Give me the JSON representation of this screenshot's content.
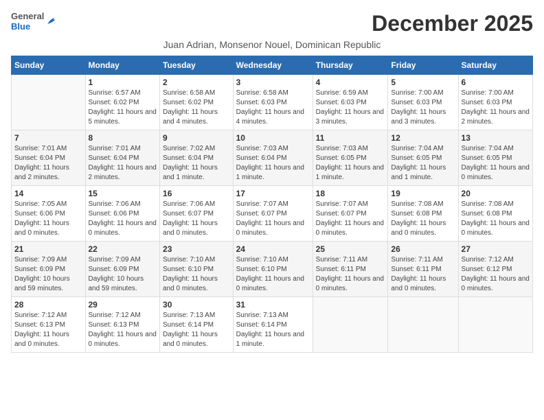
{
  "logo": {
    "text_general": "General",
    "text_blue": "Blue"
  },
  "title": "December 2025",
  "subtitle": "Juan Adrian, Monsenor Nouel, Dominican Republic",
  "weekdays": [
    "Sunday",
    "Monday",
    "Tuesday",
    "Wednesday",
    "Thursday",
    "Friday",
    "Saturday"
  ],
  "weeks": [
    [
      {
        "day": "",
        "empty": true
      },
      {
        "day": "1",
        "sunrise": "Sunrise: 6:57 AM",
        "sunset": "Sunset: 6:02 PM",
        "daylight": "Daylight: 11 hours and 5 minutes."
      },
      {
        "day": "2",
        "sunrise": "Sunrise: 6:58 AM",
        "sunset": "Sunset: 6:02 PM",
        "daylight": "Daylight: 11 hours and 4 minutes."
      },
      {
        "day": "3",
        "sunrise": "Sunrise: 6:58 AM",
        "sunset": "Sunset: 6:03 PM",
        "daylight": "Daylight: 11 hours and 4 minutes."
      },
      {
        "day": "4",
        "sunrise": "Sunrise: 6:59 AM",
        "sunset": "Sunset: 6:03 PM",
        "daylight": "Daylight: 11 hours and 3 minutes."
      },
      {
        "day": "5",
        "sunrise": "Sunrise: 7:00 AM",
        "sunset": "Sunset: 6:03 PM",
        "daylight": "Daylight: 11 hours and 3 minutes."
      },
      {
        "day": "6",
        "sunrise": "Sunrise: 7:00 AM",
        "sunset": "Sunset: 6:03 PM",
        "daylight": "Daylight: 11 hours and 2 minutes."
      }
    ],
    [
      {
        "day": "7",
        "sunrise": "Sunrise: 7:01 AM",
        "sunset": "Sunset: 6:04 PM",
        "daylight": "Daylight: 11 hours and 2 minutes."
      },
      {
        "day": "8",
        "sunrise": "Sunrise: 7:01 AM",
        "sunset": "Sunset: 6:04 PM",
        "daylight": "Daylight: 11 hours and 2 minutes."
      },
      {
        "day": "9",
        "sunrise": "Sunrise: 7:02 AM",
        "sunset": "Sunset: 6:04 PM",
        "daylight": "Daylight: 11 hours and 1 minute."
      },
      {
        "day": "10",
        "sunrise": "Sunrise: 7:03 AM",
        "sunset": "Sunset: 6:04 PM",
        "daylight": "Daylight: 11 hours and 1 minute."
      },
      {
        "day": "11",
        "sunrise": "Sunrise: 7:03 AM",
        "sunset": "Sunset: 6:05 PM",
        "daylight": "Daylight: 11 hours and 1 minute."
      },
      {
        "day": "12",
        "sunrise": "Sunrise: 7:04 AM",
        "sunset": "Sunset: 6:05 PM",
        "daylight": "Daylight: 11 hours and 1 minute."
      },
      {
        "day": "13",
        "sunrise": "Sunrise: 7:04 AM",
        "sunset": "Sunset: 6:05 PM",
        "daylight": "Daylight: 11 hours and 0 minutes."
      }
    ],
    [
      {
        "day": "14",
        "sunrise": "Sunrise: 7:05 AM",
        "sunset": "Sunset: 6:06 PM",
        "daylight": "Daylight: 11 hours and 0 minutes."
      },
      {
        "day": "15",
        "sunrise": "Sunrise: 7:06 AM",
        "sunset": "Sunset: 6:06 PM",
        "daylight": "Daylight: 11 hours and 0 minutes."
      },
      {
        "day": "16",
        "sunrise": "Sunrise: 7:06 AM",
        "sunset": "Sunset: 6:07 PM",
        "daylight": "Daylight: 11 hours and 0 minutes."
      },
      {
        "day": "17",
        "sunrise": "Sunrise: 7:07 AM",
        "sunset": "Sunset: 6:07 PM",
        "daylight": "Daylight: 11 hours and 0 minutes."
      },
      {
        "day": "18",
        "sunrise": "Sunrise: 7:07 AM",
        "sunset": "Sunset: 6:07 PM",
        "daylight": "Daylight: 11 hours and 0 minutes."
      },
      {
        "day": "19",
        "sunrise": "Sunrise: 7:08 AM",
        "sunset": "Sunset: 6:08 PM",
        "daylight": "Daylight: 11 hours and 0 minutes."
      },
      {
        "day": "20",
        "sunrise": "Sunrise: 7:08 AM",
        "sunset": "Sunset: 6:08 PM",
        "daylight": "Daylight: 11 hours and 0 minutes."
      }
    ],
    [
      {
        "day": "21",
        "sunrise": "Sunrise: 7:09 AM",
        "sunset": "Sunset: 6:09 PM",
        "daylight": "Daylight: 10 hours and 59 minutes."
      },
      {
        "day": "22",
        "sunrise": "Sunrise: 7:09 AM",
        "sunset": "Sunset: 6:09 PM",
        "daylight": "Daylight: 10 hours and 59 minutes."
      },
      {
        "day": "23",
        "sunrise": "Sunrise: 7:10 AM",
        "sunset": "Sunset: 6:10 PM",
        "daylight": "Daylight: 11 hours and 0 minutes."
      },
      {
        "day": "24",
        "sunrise": "Sunrise: 7:10 AM",
        "sunset": "Sunset: 6:10 PM",
        "daylight": "Daylight: 11 hours and 0 minutes."
      },
      {
        "day": "25",
        "sunrise": "Sunrise: 7:11 AM",
        "sunset": "Sunset: 6:11 PM",
        "daylight": "Daylight: 11 hours and 0 minutes."
      },
      {
        "day": "26",
        "sunrise": "Sunrise: 7:11 AM",
        "sunset": "Sunset: 6:11 PM",
        "daylight": "Daylight: 11 hours and 0 minutes."
      },
      {
        "day": "27",
        "sunrise": "Sunrise: 7:12 AM",
        "sunset": "Sunset: 6:12 PM",
        "daylight": "Daylight: 11 hours and 0 minutes."
      }
    ],
    [
      {
        "day": "28",
        "sunrise": "Sunrise: 7:12 AM",
        "sunset": "Sunset: 6:13 PM",
        "daylight": "Daylight: 11 hours and 0 minutes."
      },
      {
        "day": "29",
        "sunrise": "Sunrise: 7:12 AM",
        "sunset": "Sunset: 6:13 PM",
        "daylight": "Daylight: 11 hours and 0 minutes."
      },
      {
        "day": "30",
        "sunrise": "Sunrise: 7:13 AM",
        "sunset": "Sunset: 6:14 PM",
        "daylight": "Daylight: 11 hours and 0 minutes."
      },
      {
        "day": "31",
        "sunrise": "Sunrise: 7:13 AM",
        "sunset": "Sunset: 6:14 PM",
        "daylight": "Daylight: 11 hours and 1 minute."
      },
      {
        "day": "",
        "empty": true
      },
      {
        "day": "",
        "empty": true
      },
      {
        "day": "",
        "empty": true
      }
    ]
  ]
}
